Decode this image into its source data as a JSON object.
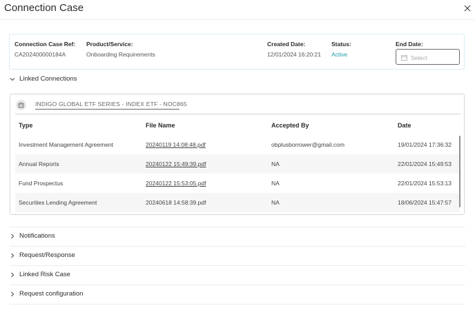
{
  "dialog": {
    "title": "Connection Case"
  },
  "case": {
    "ref_label": "Connection Case Ref:",
    "ref_value": "CA202400000184A",
    "product_label": "Product/Service:",
    "product_value": "Onboarding Requirements",
    "created_label": "Created Date:",
    "created_value": "12/01/2024 16:20:21",
    "status_label": "Status:",
    "status_value": "Active",
    "end_label": "End Date:",
    "end_placeholder": "Select"
  },
  "linked": {
    "section_label": "Linked Connections",
    "connection_name": "INDIGO GLOBAL ETF SERIES - INDEX ETF - NOC865",
    "columns": [
      "Type",
      "File Name",
      "Accepted By",
      "Date"
    ],
    "rows": [
      {
        "type": "Investment Management Agreement",
        "file": "20240119 14:08:48.pdf",
        "accepted": "obplusborrower@gmail.com",
        "date": "19/01/2024 17:36:32"
      },
      {
        "type": "Annual Reports",
        "file": "20240122 15:49:39.pdf",
        "accepted": "NA",
        "date": "22/01/2024 15:49:53"
      },
      {
        "type": "Fund Prospectus",
        "file": "20240122 15:53:05.pdf",
        "accepted": "NA",
        "date": "22/01/2024 15:53:13"
      },
      {
        "type": "Securities Lending Agreement",
        "file": "20240618 14:58:39.pdf",
        "accepted": "NA",
        "date": "18/06/2024 15:47:57"
      }
    ]
  },
  "sections": [
    "Notifications",
    "Request/Response",
    "Linked Risk Case",
    "Request configuration"
  ],
  "icons": {
    "close": "close-icon",
    "expanded": "chevron-down-icon",
    "collapsed": "chevron-right-icon",
    "calendar": "calendar-icon",
    "connection": "building-icon"
  },
  "colors": {
    "status_active": "#1b9aa8",
    "box_border": "#d6eef3"
  }
}
